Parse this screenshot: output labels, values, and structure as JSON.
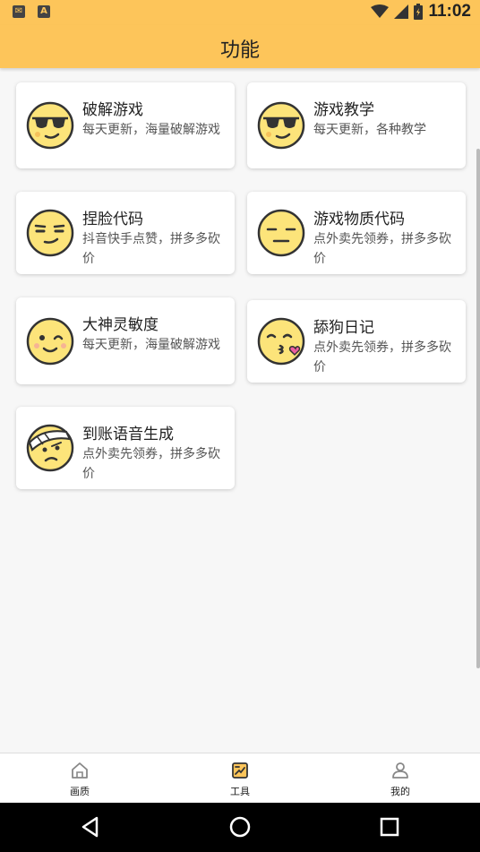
{
  "statusbar": {
    "left_icons": [
      "mail-icon",
      "a-icon"
    ],
    "left_glyphs": [
      "✉",
      "A"
    ],
    "time": "11:02"
  },
  "header": {
    "title": "功能"
  },
  "cards": [
    {
      "title": "破解游戏",
      "desc": "每天更新，海量破解游戏",
      "icon": "sunglasses-face-icon"
    },
    {
      "title": "游戏教学",
      "desc": "每天更新，各种教学",
      "icon": "sunglasses-face-icon"
    },
    {
      "title": "捏脸代码",
      "desc": "抖音快手点赞，拼多多砍价",
      "icon": "smirk-face-icon"
    },
    {
      "title": "游戏物质代码",
      "desc": "点外卖先领券，拼多多砍价",
      "icon": "neutral-face-icon"
    },
    {
      "title": "大神灵敏度",
      "desc": "每天更新，海量破解游戏",
      "icon": "wink-face-icon"
    },
    {
      "title": "舔狗日记",
      "desc": "点外卖先领券，拼多多砍价",
      "icon": "kiss-face-icon"
    },
    {
      "title": "到账语音生成",
      "desc": "点外卖先领券，拼多多砍价",
      "icon": "bandage-face-icon"
    }
  ],
  "bottom_nav": [
    {
      "label": "画质",
      "icon": "home-icon",
      "active": false
    },
    {
      "label": "工具",
      "icon": "tools-icon",
      "active": true
    },
    {
      "label": "我的",
      "icon": "user-icon",
      "active": false
    }
  ],
  "colors": {
    "primary": "#fdc55a",
    "face": "#fce47a",
    "face_outline": "#333333"
  }
}
